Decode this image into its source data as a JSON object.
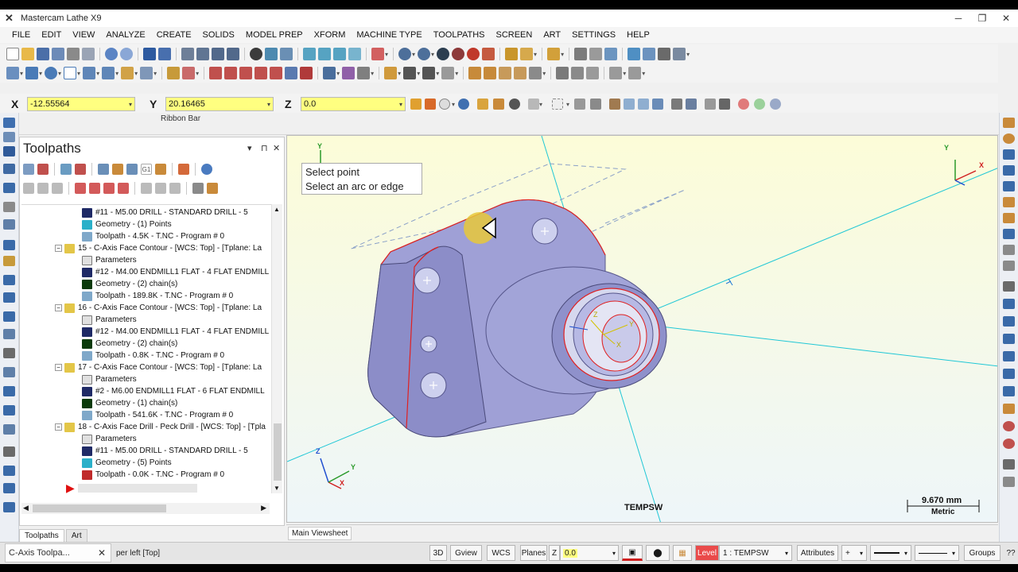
{
  "app": {
    "title": "Mastercam Lathe X9"
  },
  "menu": [
    "FILE",
    "EDIT",
    "VIEW",
    "ANALYZE",
    "CREATE",
    "SOLIDS",
    "MODEL PREP",
    "XFORM",
    "MACHINE TYPE",
    "TOOLPATHS",
    "SCREEN",
    "ART",
    "SETTINGS",
    "HELP"
  ],
  "coords": {
    "x_label": "X",
    "x_value": "-12.55564",
    "y_label": "Y",
    "y_value": "20.16465",
    "z_label": "Z",
    "z_value": "0.0"
  },
  "ribbon_bar_label": "Ribbon Bar",
  "panel": {
    "title": "Toolpaths",
    "tree": [
      {
        "level": 3,
        "icon": "tool",
        "text": "#11 - M5.00 DRILL - STANDARD DRILL - 5"
      },
      {
        "level": 3,
        "icon": "geometry",
        "text": "Geometry - (1) Points"
      },
      {
        "level": 3,
        "icon": "toolpath",
        "text": "Toolpath - 4.5K - T.NC - Program # 0"
      },
      {
        "level": 1,
        "icon": "folder",
        "text": "15 - C-Axis Face Contour - [WCS: Top] - [Tplane: La"
      },
      {
        "level": 2,
        "icon": "params",
        "text": "Parameters"
      },
      {
        "level": 3,
        "icon": "tool",
        "text": "#12 - M4.00 ENDMILL1 FLAT - 4 FLAT ENDMILL"
      },
      {
        "level": 3,
        "icon": "chain",
        "text": "Geometry - (2) chain(s)"
      },
      {
        "level": 3,
        "icon": "toolpath",
        "text": "Toolpath - 189.8K - T.NC - Program # 0"
      },
      {
        "level": 1,
        "icon": "folder",
        "text": "16 - C-Axis Face Contour - [WCS: Top] - [Tplane: La"
      },
      {
        "level": 2,
        "icon": "params",
        "text": "Parameters"
      },
      {
        "level": 3,
        "icon": "tool",
        "text": "#12 - M4.00 ENDMILL1 FLAT - 4 FLAT ENDMILL"
      },
      {
        "level": 3,
        "icon": "chain",
        "text": "Geometry - (2) chain(s)"
      },
      {
        "level": 3,
        "icon": "toolpath",
        "text": "Toolpath - 0.8K - T.NC - Program # 0"
      },
      {
        "level": 1,
        "icon": "folder",
        "text": "17 - C-Axis Face Contour - [WCS: Top] - [Tplane: La"
      },
      {
        "level": 2,
        "icon": "params",
        "text": "Parameters"
      },
      {
        "level": 3,
        "icon": "tool",
        "text": "#2 - M6.00 ENDMILL1 FLAT - 6 FLAT ENDMILL"
      },
      {
        "level": 3,
        "icon": "chain",
        "text": "Geometry - (1) chain(s)"
      },
      {
        "level": 3,
        "icon": "toolpath",
        "text": "Toolpath - 541.6K - T.NC - Program # 0"
      },
      {
        "level": 1,
        "icon": "folder",
        "text": "18 - C-Axis Face Drill - Peck Drill - [WCS: Top] - [Tpla"
      },
      {
        "level": 2,
        "icon": "params",
        "text": "Parameters"
      },
      {
        "level": 3,
        "icon": "tool",
        "text": "#11 - M5.00 DRILL - STANDARD DRILL - 5"
      },
      {
        "level": 3,
        "icon": "geometry",
        "text": "Geometry - (5) Points"
      },
      {
        "level": 3,
        "icon": "toolpath-dirty",
        "text": "Toolpath - 0.0K - T.NC - Program # 0"
      }
    ],
    "tabs": [
      "Toolpaths",
      "Art"
    ]
  },
  "viewport": {
    "tooltip_line1": "Select point",
    "tooltip_line2": "Select an arc or edge",
    "plane_label": "TEMPSW",
    "scale_value": "9.670 mm",
    "scale_units": "Metric",
    "sheet_tab": "Main Viewsheet",
    "axis_x": "X",
    "axis_y": "Y",
    "axis_z": "Z"
  },
  "statusbar": {
    "task_label": "C-Axis Toolpa...",
    "view_label": "per left [Top]",
    "btn_3d": "3D",
    "btn_gview": "Gview",
    "btn_wcs": "WCS",
    "btn_planes": "Planes",
    "z_label": "Z",
    "z_value": "0.0",
    "level_label": "Level",
    "level_value": "1 : TEMPSW",
    "btn_attributes": "Attributes",
    "btn_groups": "Groups",
    "help": "??"
  },
  "colors": {
    "accent_yellow": "#ffff80",
    "part_body": "#a9a9d9",
    "toolpath_red": "#e02020",
    "axis_cyan": "#1fc7d6"
  }
}
